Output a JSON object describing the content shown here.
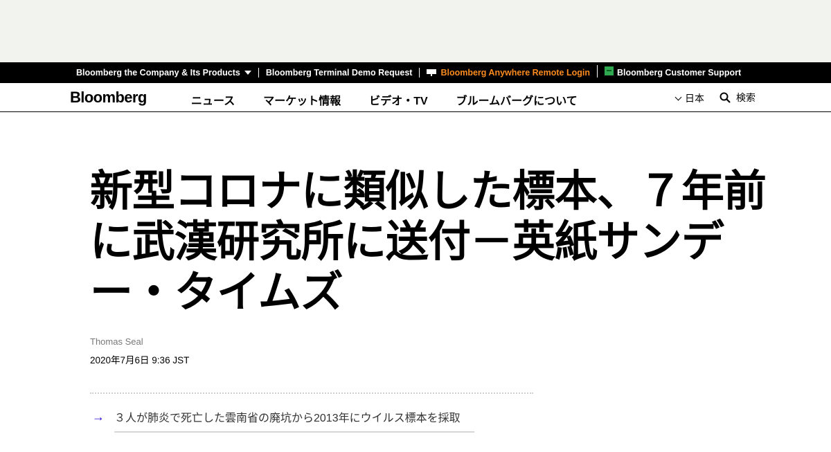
{
  "top_bar": {
    "company_label": "Bloomberg the Company & Its Products",
    "terminal_demo_label": "Bloomberg Terminal Demo Request",
    "anywhere_label": "Bloomberg Anywhere Remote Login",
    "support_label": "Bloomberg Customer Support",
    "accent_color": "#fb8b1e"
  },
  "nav": {
    "logo": "Bloomberg",
    "links": [
      "ニュース",
      "マーケット情報",
      "ビデオ・TV",
      "ブルームバーグについて"
    ],
    "region": "日本",
    "search_label": "検索"
  },
  "article": {
    "headline": "新型コロナに類似した標本、７年前に武漢研究所に送付－英紙サンデー・タイムズ",
    "author": "Thomas Seal",
    "date": "2020年7月6日 9:36 JST",
    "bullets": [
      "３人が肺炎で死亡した雲南省の廃坑から2013年にウイルス標本を採取"
    ],
    "bullet_color": "#2800d7"
  }
}
